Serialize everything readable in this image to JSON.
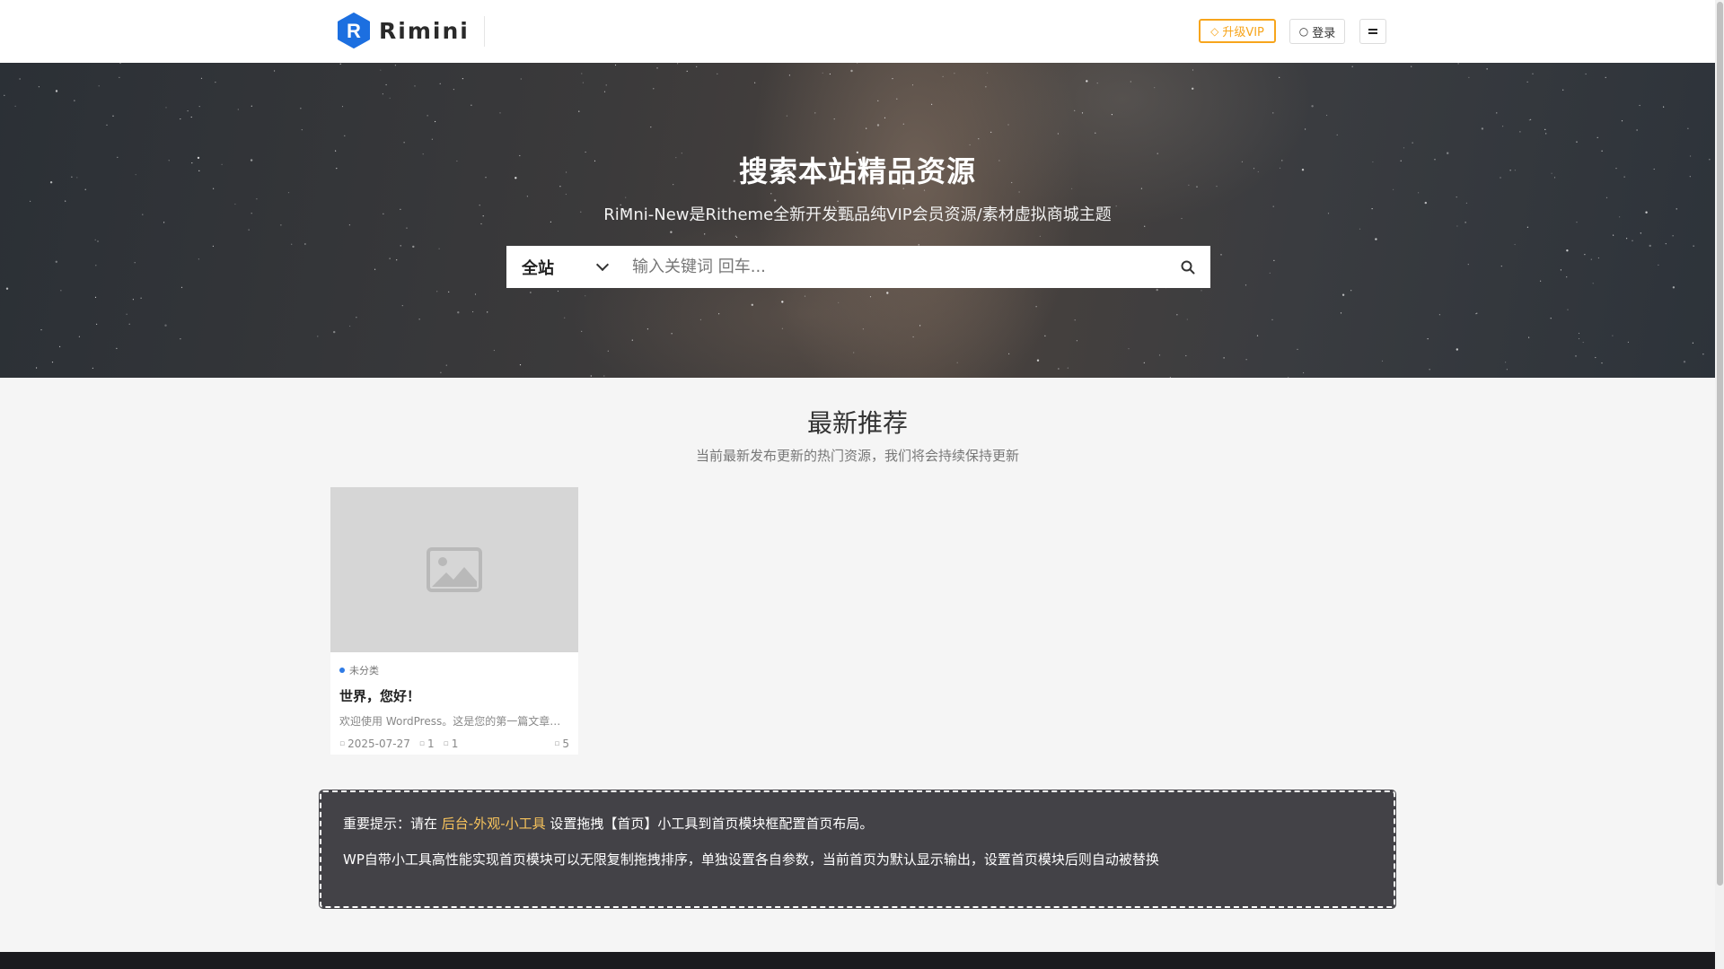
{
  "header": {
    "logo_text": "Rimini",
    "logo_letter": "R",
    "vip_label": "升级VIP",
    "login_label": "登录",
    "menu_icon": "menu-icon"
  },
  "hero": {
    "title": "搜索本站精品资源",
    "subtitle": "RiMni-New是Ritheme全新开发甄品纯VIP会员资源/素材虚拟商城主题",
    "search": {
      "scope": "全站",
      "placeholder": "输入关键词 回车...",
      "value": ""
    }
  },
  "section": {
    "title": "最新推荐",
    "subtitle": "当前最新发布更新的热门资源，我们将会持续保持更新"
  },
  "posts": [
    {
      "category": "未分类",
      "title": "世界，您好！",
      "excerpt": "欢迎使用 WordPress。这是您的第一篇文章。编辑或删除它，然后开始写作吧！",
      "date": "2025-07-27",
      "views": "1",
      "likes": "1",
      "comments": "5"
    }
  ],
  "notice": {
    "line1_prefix": "重要提示：请在 ",
    "line1_link": "后台-外观-小工具",
    "line1_suffix": " 设置拖拽【首页】小工具到首页模块框配置首页布局。",
    "line2": "WP自带小工具高性能实现首页模块可以无限复制拖拽排序，单独设置各自参数，当前首页为默认显示输出，设置首页模块后则自动被替换"
  },
  "colors": {
    "accent": "#f7a51c",
    "brand": "#1c6fe0",
    "notice_bg": "#434247",
    "link": "#f7c35c"
  }
}
